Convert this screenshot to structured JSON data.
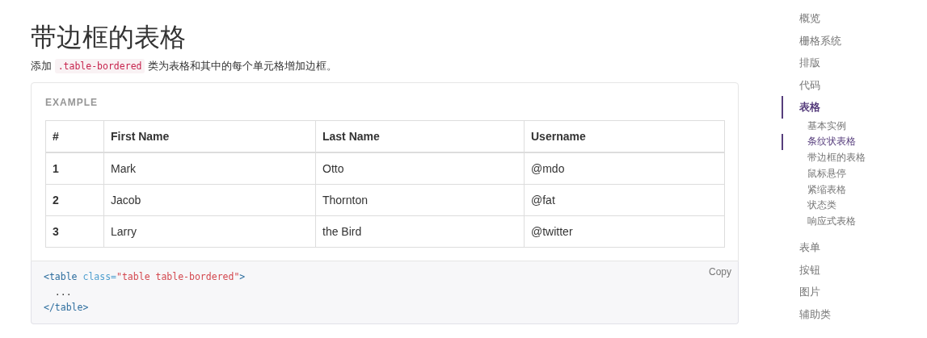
{
  "heading": "带边框的表格",
  "intro": {
    "before": "添加",
    "code": ".table-bordered",
    "after": "类为表格和其中的每个单元格增加边框。"
  },
  "example": {
    "label": "EXAMPLE",
    "table": {
      "columns": [
        "#",
        "First Name",
        "Last Name",
        "Username"
      ],
      "rows": [
        [
          "1",
          "Mark",
          "Otto",
          "@mdo"
        ],
        [
          "2",
          "Jacob",
          "Thornton",
          "@fat"
        ],
        [
          "3",
          "Larry",
          "the Bird",
          "@twitter"
        ]
      ]
    }
  },
  "code_block": {
    "copy_label": "Copy",
    "lines": [
      [
        {
          "kind": "tag",
          "text": "<table"
        },
        {
          "kind": "attr",
          "text": " class="
        },
        {
          "kind": "string",
          "text": "\"table table-bordered\""
        },
        {
          "kind": "tag",
          "text": ">"
        }
      ],
      [
        {
          "kind": "plain",
          "text": "  ..."
        }
      ],
      [
        {
          "kind": "tag",
          "text": "</table>"
        }
      ]
    ]
  },
  "sidebar": {
    "items": [
      {
        "label": "概览",
        "selected": false
      },
      {
        "label": "栅格系统",
        "selected": false
      },
      {
        "label": "排版",
        "selected": false
      },
      {
        "label": "代码",
        "selected": false
      },
      {
        "label": "表格",
        "selected": true,
        "children": [
          {
            "label": "基本实例",
            "selected": false
          },
          {
            "label": "条纹状表格",
            "selected": true
          },
          {
            "label": "带边框的表格",
            "selected": false
          },
          {
            "label": "鼠标悬停",
            "selected": false
          },
          {
            "label": "紧缩表格",
            "selected": false
          },
          {
            "label": "状态类",
            "selected": false
          },
          {
            "label": "响应式表格",
            "selected": false
          }
        ]
      },
      {
        "label": "表单",
        "selected": false
      },
      {
        "label": "按钮",
        "selected": false
      },
      {
        "label": "图片",
        "selected": false
      },
      {
        "label": "辅助类",
        "selected": false
      }
    ]
  }
}
